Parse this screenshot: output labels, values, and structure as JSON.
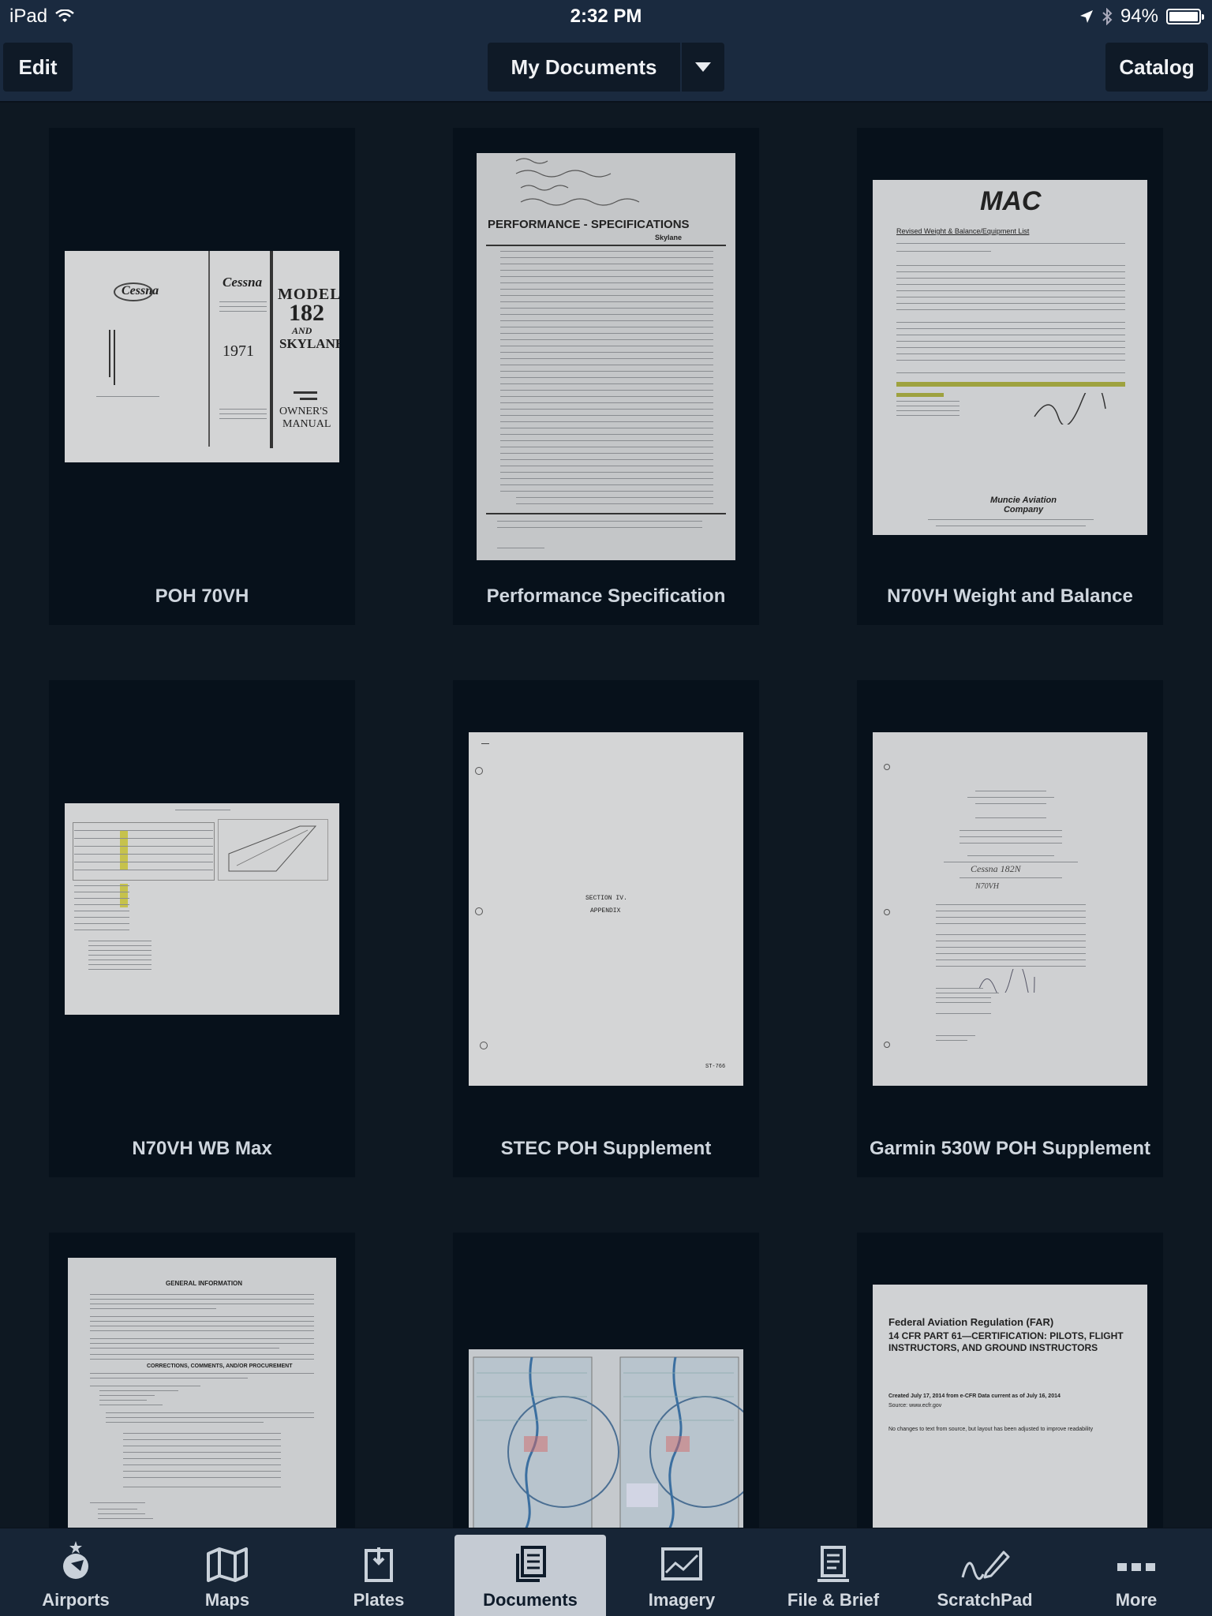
{
  "status_bar": {
    "device": "iPad",
    "time": "2:32 PM",
    "battery": "94%"
  },
  "nav": {
    "edit_label": "Edit",
    "title": "My Documents",
    "catalog_label": "Catalog"
  },
  "documents": [
    {
      "title": "POH 70VH"
    },
    {
      "title": "Performance Specification"
    },
    {
      "title": "N70VH Weight and Balance"
    },
    {
      "title": "N70VH WB Max"
    },
    {
      "title": "STEC POH Supplement"
    },
    {
      "title": "Garmin 530W POH Supplement"
    }
  ],
  "thumbs": {
    "poh": {
      "model": "MODEL",
      "num": "182",
      "and": "AND",
      "skylane": "SKYLANE",
      "year": "1971",
      "owners": "OWNER'S",
      "manual": "MANUAL",
      "brand": "Cessna"
    },
    "perf": {
      "header": "PERFORMANCE - SPECIFICATIONS",
      "sub": "Skylane"
    },
    "mac": {
      "logo": "MAC",
      "heading": "Revised Weight & Balance/Equipment List",
      "company": "Muncie Aviation Company"
    },
    "stec": {
      "section": "SECTION IV.",
      "appendix": "APPENDIX",
      "page": "ST-766"
    },
    "garmin": {
      "sig": "Cessna 182N",
      "reg": "N70VH"
    },
    "general": {
      "title": "GENERAL INFORMATION",
      "sub": "CORRECTIONS, COMMENTS, AND/OR PROCUREMENT"
    },
    "far": {
      "title": "Federal Aviation Regulation (FAR)",
      "subtitle": "14 CFR PART 61—CERTIFICATION: PILOTS, FLIGHT INSTRUCTORS, AND GROUND INSTRUCTORS",
      "created": "Created July 17, 2014 from e-CFR Data current as of July 16, 2014",
      "source": "Source: www.ecfr.gov",
      "note": "No changes to text from source, but layout has been adjusted to improve readability"
    }
  },
  "tabs": [
    {
      "label": "Airports",
      "icon": "airport-icon"
    },
    {
      "label": "Maps",
      "icon": "map-icon"
    },
    {
      "label": "Plates",
      "icon": "plates-icon"
    },
    {
      "label": "Documents",
      "icon": "documents-icon",
      "active": true
    },
    {
      "label": "Imagery",
      "icon": "imagery-icon"
    },
    {
      "label": "File & Brief",
      "icon": "file-brief-icon"
    },
    {
      "label": "ScratchPad",
      "icon": "scratchpad-icon"
    },
    {
      "label": "More",
      "icon": "more-icon"
    }
  ]
}
